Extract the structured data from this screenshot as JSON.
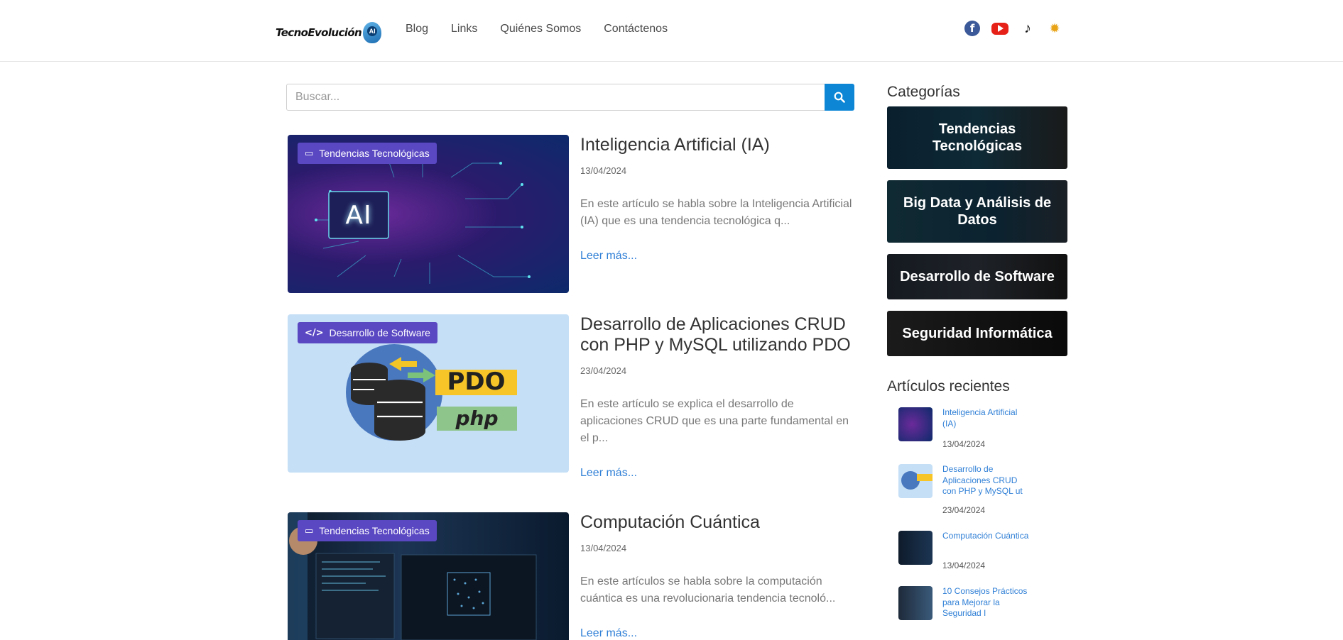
{
  "header": {
    "logo_text": "TecnoEvolución",
    "logo_badge": "AI",
    "nav": [
      "Blog",
      "Links",
      "Quiénes Somos",
      "Contáctenos"
    ],
    "social": [
      "facebook-icon",
      "youtube-icon",
      "tiktok-icon",
      "theme-toggle-icon"
    ]
  },
  "search": {
    "placeholder": "Buscar..."
  },
  "posts": [
    {
      "category": "Tendencias Tecnológicas",
      "title": "Inteligencia Artificial (IA)",
      "date": "13/04/2024",
      "excerpt": "En este artículo se habla sobre la Inteligencia Artificial (IA) que es una tendencia tecnológica q...",
      "more": "Leer más...",
      "image_text": "AI"
    },
    {
      "category": "Desarrollo de Software",
      "title": "Desarrollo de Aplicaciones CRUD con PHP y MySQL utilizando PDO",
      "date": "23/04/2024",
      "excerpt": "En este artículo se explica el desarrollo de aplicaciones CRUD que es una parte fundamental en el p...",
      "more": "Leer más...",
      "image_text_1": "PDO",
      "image_text_2": "php"
    },
    {
      "category": "Tendencias Tecnológicas",
      "title": "Computación Cuántica",
      "date": "13/04/2024",
      "excerpt": "En este artículos se habla sobre la computación cuántica es una revolucionaria tendencia tecnoló...",
      "more": "Leer más..."
    }
  ],
  "sidebar": {
    "categories_title": "Categorías",
    "categories": [
      "Tendencias Tecnológicas",
      "Big Data y Análisis de Datos",
      "Desarrollo de Software",
      "Seguridad Informática"
    ],
    "recent_title": "Artículos recientes",
    "recent": [
      {
        "title": "Inteligencia Artificial (IA)",
        "date": "13/04/2024"
      },
      {
        "title": "Desarrollo de Aplicaciones CRUD con PHP y MySQL ut",
        "date": "23/04/2024"
      },
      {
        "title": "Computación Cuántica",
        "date": "13/04/2024"
      },
      {
        "title": "10 Consejos Prácticos para Mejorar la Seguridad I",
        "date": ""
      }
    ]
  }
}
